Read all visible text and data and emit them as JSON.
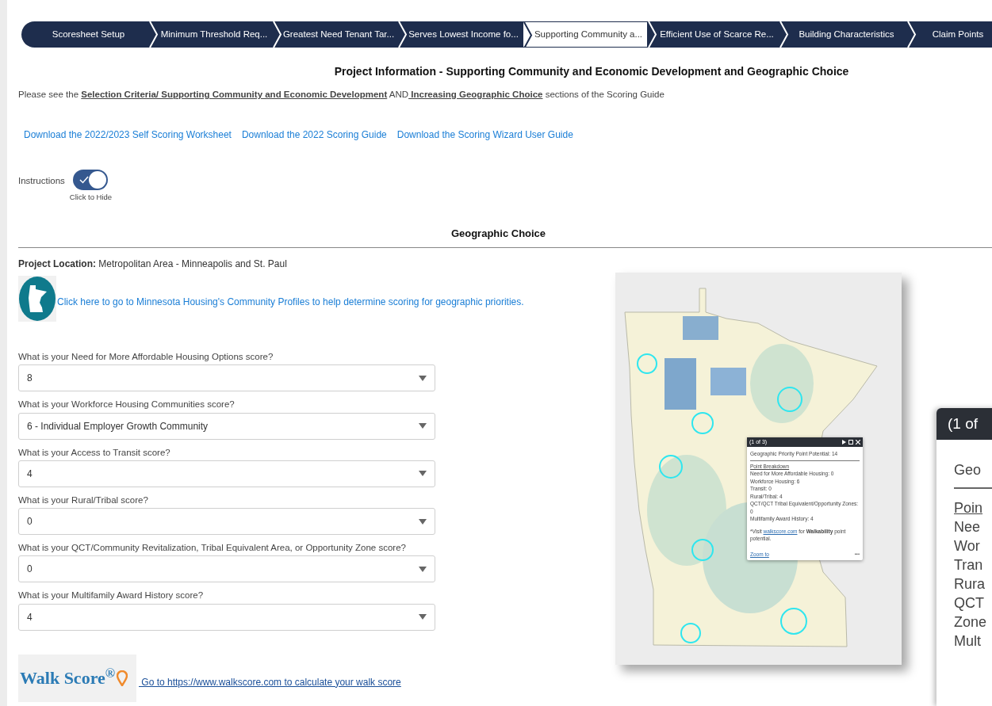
{
  "steps": [
    {
      "label": "Scoresheet Setup",
      "selected": false
    },
    {
      "label": "Minimum Threshold Req...",
      "selected": false
    },
    {
      "label": "Greatest Need Tenant Tar...",
      "selected": false
    },
    {
      "label": "Serves Lowest Income fo...",
      "selected": false
    },
    {
      "label": "Supporting Community a...",
      "selected": true
    },
    {
      "label": "Efficient Use of Scarce Re...",
      "selected": false
    },
    {
      "label": "Building Characteristics",
      "selected": false
    },
    {
      "label": "Claim Points",
      "selected": false
    }
  ],
  "page_title": "Project Information - Supporting Community and Economic Development and Geographic Choice",
  "intro": [
    {
      "kind": "text",
      "text": "Please see the "
    },
    {
      "kind": "link",
      "text": "Selection Criteria/ Supporting Community and Economic Development"
    },
    {
      "kind": "text",
      "text": " AND"
    },
    {
      "kind": "link",
      "text": " Increasing Geographic Choice"
    },
    {
      "kind": "text",
      "text": " sections of the Scoring Guide"
    }
  ],
  "downloads": [
    "Download the 2022/2023 Self Scoring Worksheet",
    "Download the 2022 Scoring Guide",
    "Download the Scoring Wizard User Guide"
  ],
  "instructions": {
    "label": "Instructions",
    "on": true,
    "caption": "Click to Hide"
  },
  "section_title": "Geographic Choice",
  "project_location": {
    "label": "Project Location:",
    "value": "Metropolitan Area - Minneapolis and St. Paul"
  },
  "profiles_link": "Click here to go to Minnesota Housing's Community Profiles to help determine scoring for geographic priorities.",
  "questions": [
    {
      "label": "What is your Need for More Affordable Housing Options score?",
      "value": "8"
    },
    {
      "label": "What is your Workforce Housing Communities score?",
      "value": "6 - Individual Employer Growth Community"
    },
    {
      "label": "What is your Access to Transit score?",
      "value": "4"
    },
    {
      "label": "What is your Rural/Tribal score?",
      "value": "0"
    },
    {
      "label": "What is your QCT/Community Revitalization, Tribal Equivalent Area, or Opportunity Zone score?",
      "value": "0"
    },
    {
      "label": "What is your Multifamily Award History score?",
      "value": "4"
    }
  ],
  "walkscore": {
    "logo": "Walk Score$^{®}$",
    "link": " Go to https://www.walkscore.com to calculate your walk score"
  },
  "map_popup": {
    "counter": "(1 of 3)",
    "heading": "Geographic Priority Point Potential: 14",
    "breakdown_title": "Point Breakdown",
    "lines": [
      "Need for More Affordable Housing: 0",
      "Workforce Housing: 6",
      "Transit: 0",
      "Rural/Tribal: 4",
      "QCT/QCT Tribal Equivalent/Opportunity Zones: 0",
      "Multifamily Award History: 4"
    ],
    "note_before": "*Visit ",
    "note_link": "walkscore.com",
    "note_after": " for **Walkability** point potential.",
    "zoom_link": "Zoom to",
    "more": "•••"
  },
  "zoomed_popup": {
    "counter": "(1 of",
    "heading": "Geo",
    "breakdown_title": "Poin",
    "lines": [
      "Nee",
      "Wor",
      "Tran",
      "Rura",
      "QCT",
      "Zone",
      "Mult"
    ]
  }
}
